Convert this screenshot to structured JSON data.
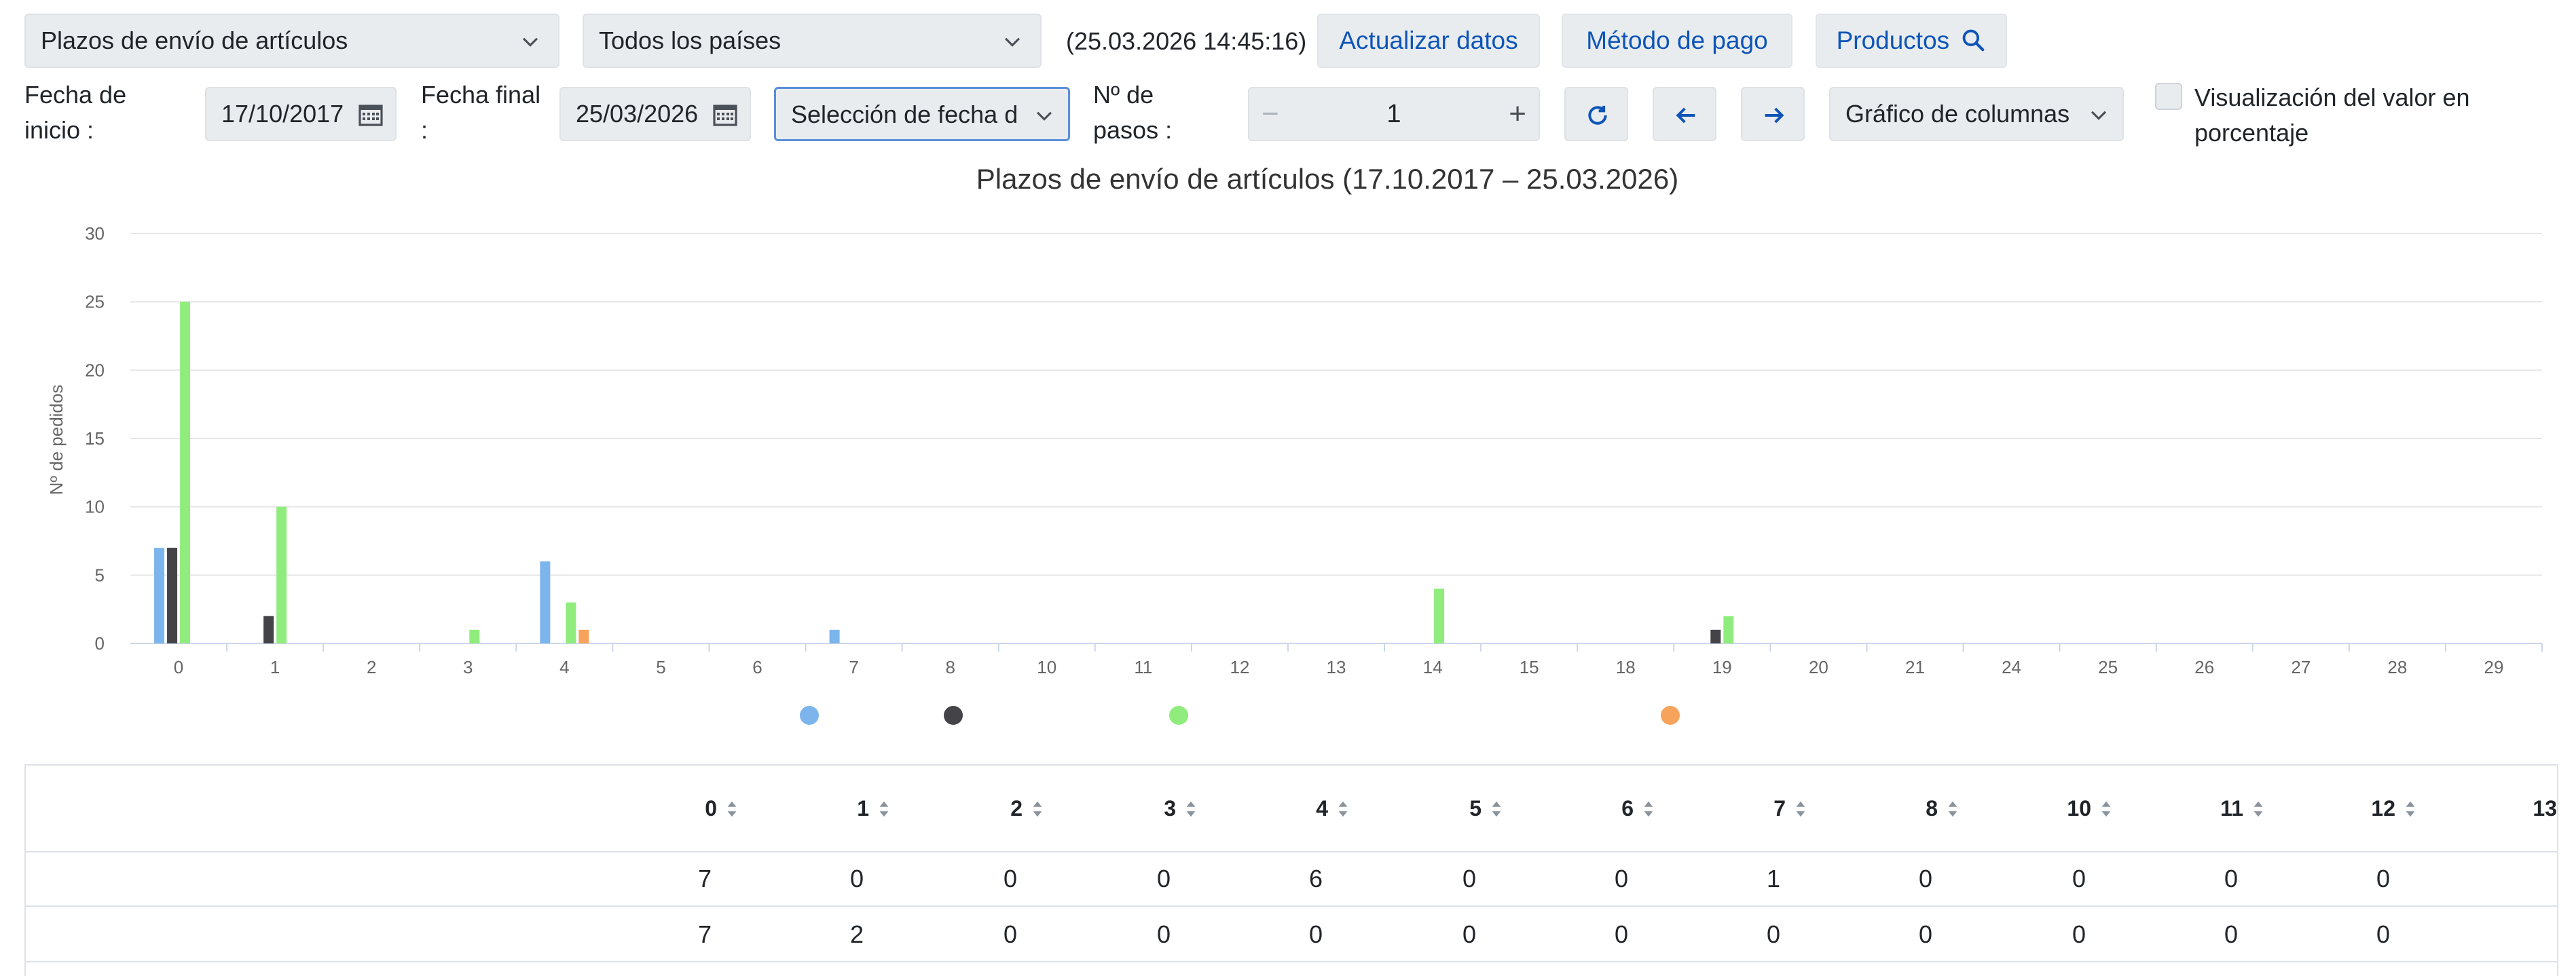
{
  "toolbar": {
    "report_select": "Plazos de envío de artículos",
    "country_select": "Todos los países",
    "timestamp": "(25.03.2026 14:45:16)",
    "refresh_label": "Actualizar datos",
    "payment_label": "Método de pago",
    "products_label": "Productos"
  },
  "filters": {
    "start_label_1": "Fecha de",
    "start_label_2": "inicio :",
    "start_value": "17/10/2017",
    "end_label_1": "Fecha final",
    "end_label_2": ":",
    "end_value": "25/03/2026",
    "date_mode_select": "Selección de fecha d",
    "steps_label_1": "Nº de",
    "steps_label_2": "pasos :",
    "steps_value": "1",
    "chart_type_select": "Gráfico de columnas",
    "percent_label_1": "Visualización del valor en",
    "percent_label_2": "porcentaje"
  },
  "colors": {
    "accent": "#0d55b8",
    "series_blue": "#7cb5ec",
    "series_dark": "#434348",
    "series_green": "#90ed7d",
    "series_orange": "#f7a35c"
  },
  "chart_data": {
    "type": "bar",
    "title": "Plazos de envío de artículos (17.10.2017 – 25.03.2026)",
    "xlabel": "",
    "ylabel": "Nº de pedidos",
    "ylim": [
      0,
      30
    ],
    "yticks": [
      "0",
      "5",
      "10",
      "15",
      "20",
      "25",
      "30"
    ],
    "grid": true,
    "legend_placement": "bottom-center",
    "categories": [
      "0",
      "1",
      "2",
      "3",
      "4",
      "5",
      "6",
      "7",
      "8",
      "10",
      "11",
      "12",
      "13",
      "14",
      "15",
      "18",
      "19",
      "20",
      "21",
      "24",
      "25",
      "26",
      "27",
      "28",
      "29"
    ],
    "series": [
      {
        "color": "#7cb5ec",
        "values": [
          7,
          0,
          0,
          0,
          6,
          0,
          0,
          1,
          0,
          0,
          0,
          0,
          0,
          0,
          0,
          0,
          0,
          0,
          0,
          0,
          0,
          0,
          0,
          0,
          0
        ]
      },
      {
        "color": "#434348",
        "values": [
          7,
          2,
          0,
          0,
          0,
          0,
          0,
          0,
          0,
          0,
          0,
          0,
          0,
          0,
          0,
          0,
          1,
          0,
          0,
          0,
          0,
          0,
          0,
          0,
          0
        ]
      },
      {
        "color": "#90ed7d",
        "values": [
          25,
          10,
          0,
          1,
          3,
          0,
          0,
          0,
          0,
          0,
          0,
          0,
          0,
          4,
          0,
          0,
          2,
          0,
          0,
          0,
          0,
          0,
          0,
          0,
          0
        ]
      },
      {
        "color": "#f7a35c",
        "values": [
          0,
          0,
          0,
          0,
          1,
          0,
          0,
          0,
          0,
          0,
          0,
          0,
          0,
          0,
          0,
          0,
          0,
          0,
          0,
          0,
          0,
          0,
          0,
          0,
          0
        ]
      }
    ]
  },
  "table": {
    "columns": [
      "0",
      "1",
      "2",
      "3",
      "4",
      "5",
      "6",
      "7",
      "8",
      "10",
      "11",
      "12",
      "13"
    ],
    "rows": [
      [
        "7",
        "0",
        "0",
        "0",
        "6",
        "0",
        "0",
        "1",
        "0",
        "0",
        "0",
        "0"
      ],
      [
        "7",
        "2",
        "0",
        "0",
        "0",
        "0",
        "0",
        "0",
        "0",
        "0",
        "0",
        "0"
      ]
    ]
  }
}
